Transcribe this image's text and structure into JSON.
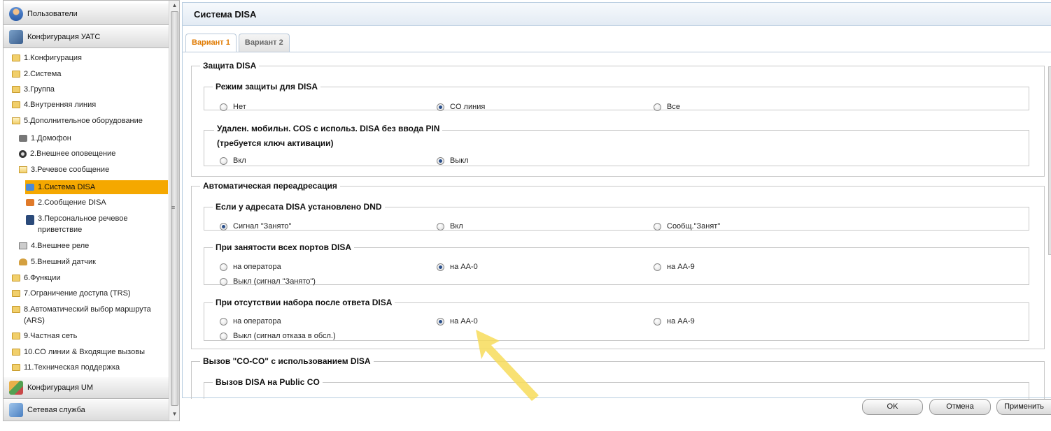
{
  "sidebar": {
    "sections": {
      "users": "Пользователи",
      "pbx_config": "Конфигурация УАТС",
      "um_config": "Конфигурация UM",
      "network": "Сетевая служба"
    },
    "tree": [
      {
        "label": "1.Конфигурация",
        "icon": "folder-icon"
      },
      {
        "label": "2.Система",
        "icon": "folder-icon"
      },
      {
        "label": "3.Группа",
        "icon": "folder-icon"
      },
      {
        "label": "4.Внутренняя линия",
        "icon": "folder-icon"
      },
      {
        "label": "5.Дополнительное оборудование",
        "icon": "folder-open-icon"
      },
      {
        "label": "1.Домофон",
        "icon": "doorphone-icon"
      },
      {
        "label": "2.Внешнее оповещение",
        "icon": "speaker-icon"
      },
      {
        "label": "3.Речевое сообщение",
        "icon": "folder-open-icon"
      },
      {
        "label": "1.Система DISA",
        "icon": "disa-icon",
        "selected": true
      },
      {
        "label": "2.Сообщение DISA",
        "icon": "message-icon"
      },
      {
        "label": "3.Персональное речевое приветствие",
        "icon": "greeting-icon"
      },
      {
        "label": "4.Внешнее реле",
        "icon": "relay-icon"
      },
      {
        "label": "5.Внешний датчик",
        "icon": "sensor-icon"
      },
      {
        "label": "6.Функции",
        "icon": "folder-icon"
      },
      {
        "label": "7.Ограничение доступа (TRS)",
        "icon": "folder-icon"
      },
      {
        "label": "8.Автоматический выбор маршрута (ARS)",
        "icon": "folder-icon"
      },
      {
        "label": "9.Частная сеть",
        "icon": "folder-icon"
      },
      {
        "label": "10.CO линии & Входящие вызовы",
        "icon": "folder-icon"
      },
      {
        "label": "11.Техническая поддержка",
        "icon": "folder-icon"
      }
    ],
    "selected_color": "#f5a800"
  },
  "main": {
    "title": "Система DISA",
    "tabs": [
      "Вариант 1",
      "Вариант 2"
    ],
    "active_tab": "Вариант 1",
    "active_tab_color": "#e07a00",
    "groups": {
      "protection": {
        "title": "Защита DISA",
        "mode_title": "Режим защиты для DISA",
        "mode_options": [
          "Нет",
          "CO линия",
          "Все"
        ],
        "mode_selected": "CO линия",
        "mobile_title_line1": "Удален. мобильн. COS с использ. DISA без ввода PIN",
        "mobile_title_line2": "(требуется ключ активации)",
        "mobile_options": [
          "Вкл",
          "Выкл"
        ],
        "mobile_selected": "Выкл"
      },
      "redirect": {
        "title": "Автоматическая переадресация",
        "dnd_title": "Если у адресата DISA установлено DND",
        "dnd_options": [
          "Сигнал \"Занято\"",
          "Вкл",
          "Сообщ.\"Занят\""
        ],
        "dnd_selected": "Сигнал \"Занято\"",
        "busy_title": "При занятости всех портов DISA",
        "busy_options": [
          "на оператора",
          "на AA-0",
          "на AA-9",
          "Выкл (сигнал \"Занято\")"
        ],
        "busy_selected": "на AA-0",
        "nodial_title": "При отсутствии набора после ответа DISA",
        "nodial_options": [
          "на оператора",
          "на AA-0",
          "на AA-9",
          "Выкл (сигнал отказа в обсл.)"
        ],
        "nodial_selected": "на AA-0"
      },
      "coco": {
        "title": "Вызов \"CO-CO\" с использованием DISA",
        "public_title": "Вызов DISA на Public CO"
      }
    }
  },
  "buttons": {
    "ok": "OK",
    "cancel": "Отмена",
    "apply": "Применить"
  },
  "highlight_arrow_color": "#f7dc5a"
}
